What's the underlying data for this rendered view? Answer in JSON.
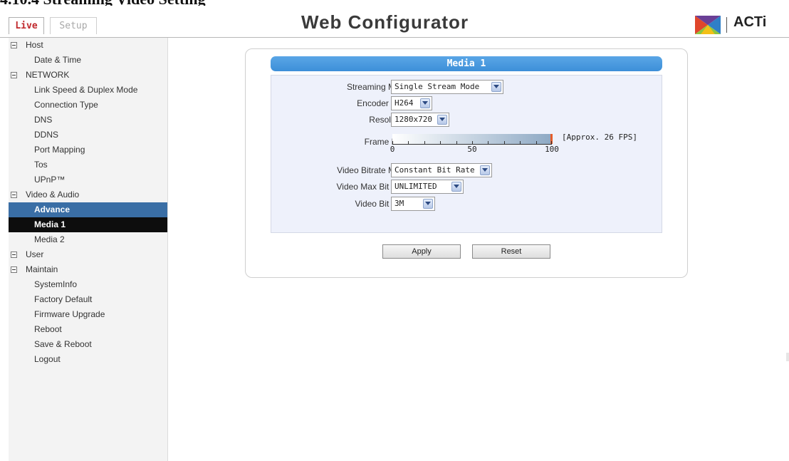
{
  "doc_heading": "4.10.4      Streaming Video Setting",
  "header": {
    "tabs": [
      {
        "label": "Live",
        "active": true
      },
      {
        "label": "Setup",
        "active": false
      }
    ],
    "title": "Web Configurator",
    "logo_text": "ACTi"
  },
  "sidebar": {
    "items": [
      {
        "label": "Host",
        "type": "section"
      },
      {
        "label": "Date & Time",
        "type": "item"
      },
      {
        "label": "NETWORK",
        "type": "section"
      },
      {
        "label": "Link Speed & Duplex Mode",
        "type": "item"
      },
      {
        "label": "Connection Type",
        "type": "item"
      },
      {
        "label": "DNS",
        "type": "item"
      },
      {
        "label": "DDNS",
        "type": "item"
      },
      {
        "label": "Port Mapping",
        "type": "item"
      },
      {
        "label": "Tos",
        "type": "item"
      },
      {
        "label": "UPnP™",
        "type": "item"
      },
      {
        "label": "Video & Audio",
        "type": "section"
      },
      {
        "label": "Advance",
        "type": "item",
        "state": "highlighted"
      },
      {
        "label": "Media 1",
        "type": "item",
        "state": "selected"
      },
      {
        "label": "Media 2",
        "type": "item"
      },
      {
        "label": "User",
        "type": "section"
      },
      {
        "label": "Maintain",
        "type": "section"
      },
      {
        "label": "SystemInfo",
        "type": "item"
      },
      {
        "label": "Factory Default",
        "type": "item"
      },
      {
        "label": "Firmware Upgrade",
        "type": "item"
      },
      {
        "label": "Reboot",
        "type": "item"
      },
      {
        "label": "Save & Reboot",
        "type": "item"
      },
      {
        "label": "Logout",
        "type": "item"
      }
    ]
  },
  "panel": {
    "title": "Media 1",
    "fields": {
      "streaming_mode": {
        "label": "Streaming Mode",
        "value": "Single Stream Mode"
      },
      "encoder_type": {
        "label": "Encoder Type",
        "value": "H264"
      },
      "resolution": {
        "label": "Resolution",
        "value": "1280x720"
      },
      "frame_rate": {
        "label": "Frame Rate",
        "value": 100,
        "min": 0,
        "max": 100,
        "tick_labels": [
          "0",
          "50",
          "100"
        ],
        "approx_text": "[Approx. 26 FPS]"
      },
      "video_bitrate_mode": {
        "label": "Video Bitrate Mode",
        "value": "Constant Bit Rate"
      },
      "video_max_bit_rate": {
        "label": "Video Max Bit Rate",
        "value": "UNLIMITED"
      },
      "video_bit_rate": {
        "label": "Video Bit Rate",
        "value": "3M"
      }
    },
    "buttons": {
      "apply": "Apply",
      "reset": "Reset"
    }
  },
  "colors": {
    "accent_blue": "#3d8fd8",
    "selected_bg": "#0d0d0d",
    "highlight_bg": "#3a6ea5",
    "live_tab_text": "#c0282c",
    "slider_handle": "#e65c2a"
  },
  "icons": {
    "toggle": "collapse-box-icon",
    "dropdown": "chevron-down-icon",
    "logo": "acti-logo-icon"
  }
}
